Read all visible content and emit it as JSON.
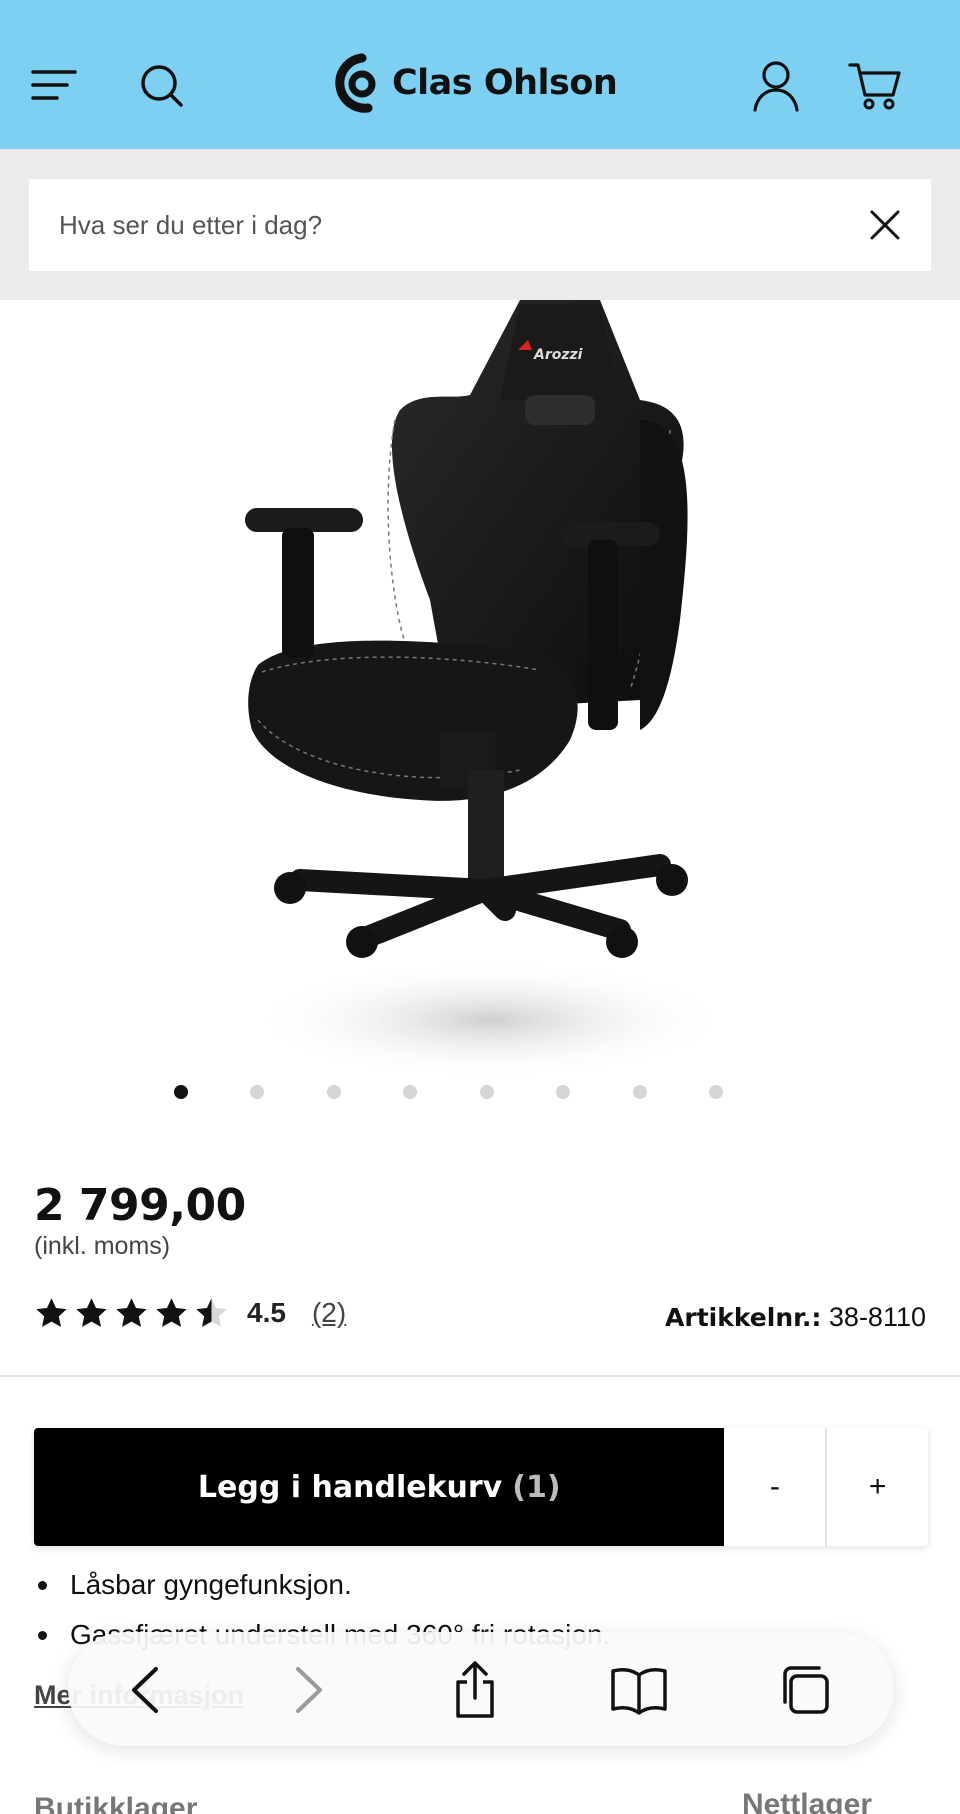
{
  "header": {
    "brand": "Clas Ohlson",
    "brand_color": "#7dd0f2",
    "icons": [
      "menu-icon",
      "search-icon",
      "user-icon",
      "cart-icon"
    ]
  },
  "search": {
    "placeholder": "Hva ser du etter i dag?",
    "value": ""
  },
  "gallery": {
    "image": "gaming chair (Arozzi)",
    "brand_marking": "Arozzi",
    "slide_count": 8,
    "active_slide": 1
  },
  "product": {
    "price": "2 799,00",
    "price_note": "(inkl. moms)",
    "rating_value": "4.5",
    "rating_stars": 4.5,
    "rating_count": "(2)",
    "article_label": "Artikkelnr.:",
    "article_number": "38-8110"
  },
  "features": [
    "Låsbar gyngefunksjon.",
    "Gassfjæret understell med 360° fri rotasjon."
  ],
  "links": {
    "more_info": "Mer informasjon"
  },
  "stock": {
    "store": "Butikklager",
    "online": "Nettlager"
  },
  "cart_bar": {
    "add_label": "Legg i handlekurv",
    "quantity": "(1)",
    "minus": "-",
    "plus": "+"
  },
  "browser": {
    "icons": [
      "back-icon",
      "forward-icon",
      "share-icon",
      "bookmarks-icon",
      "tabs-icon"
    ]
  }
}
